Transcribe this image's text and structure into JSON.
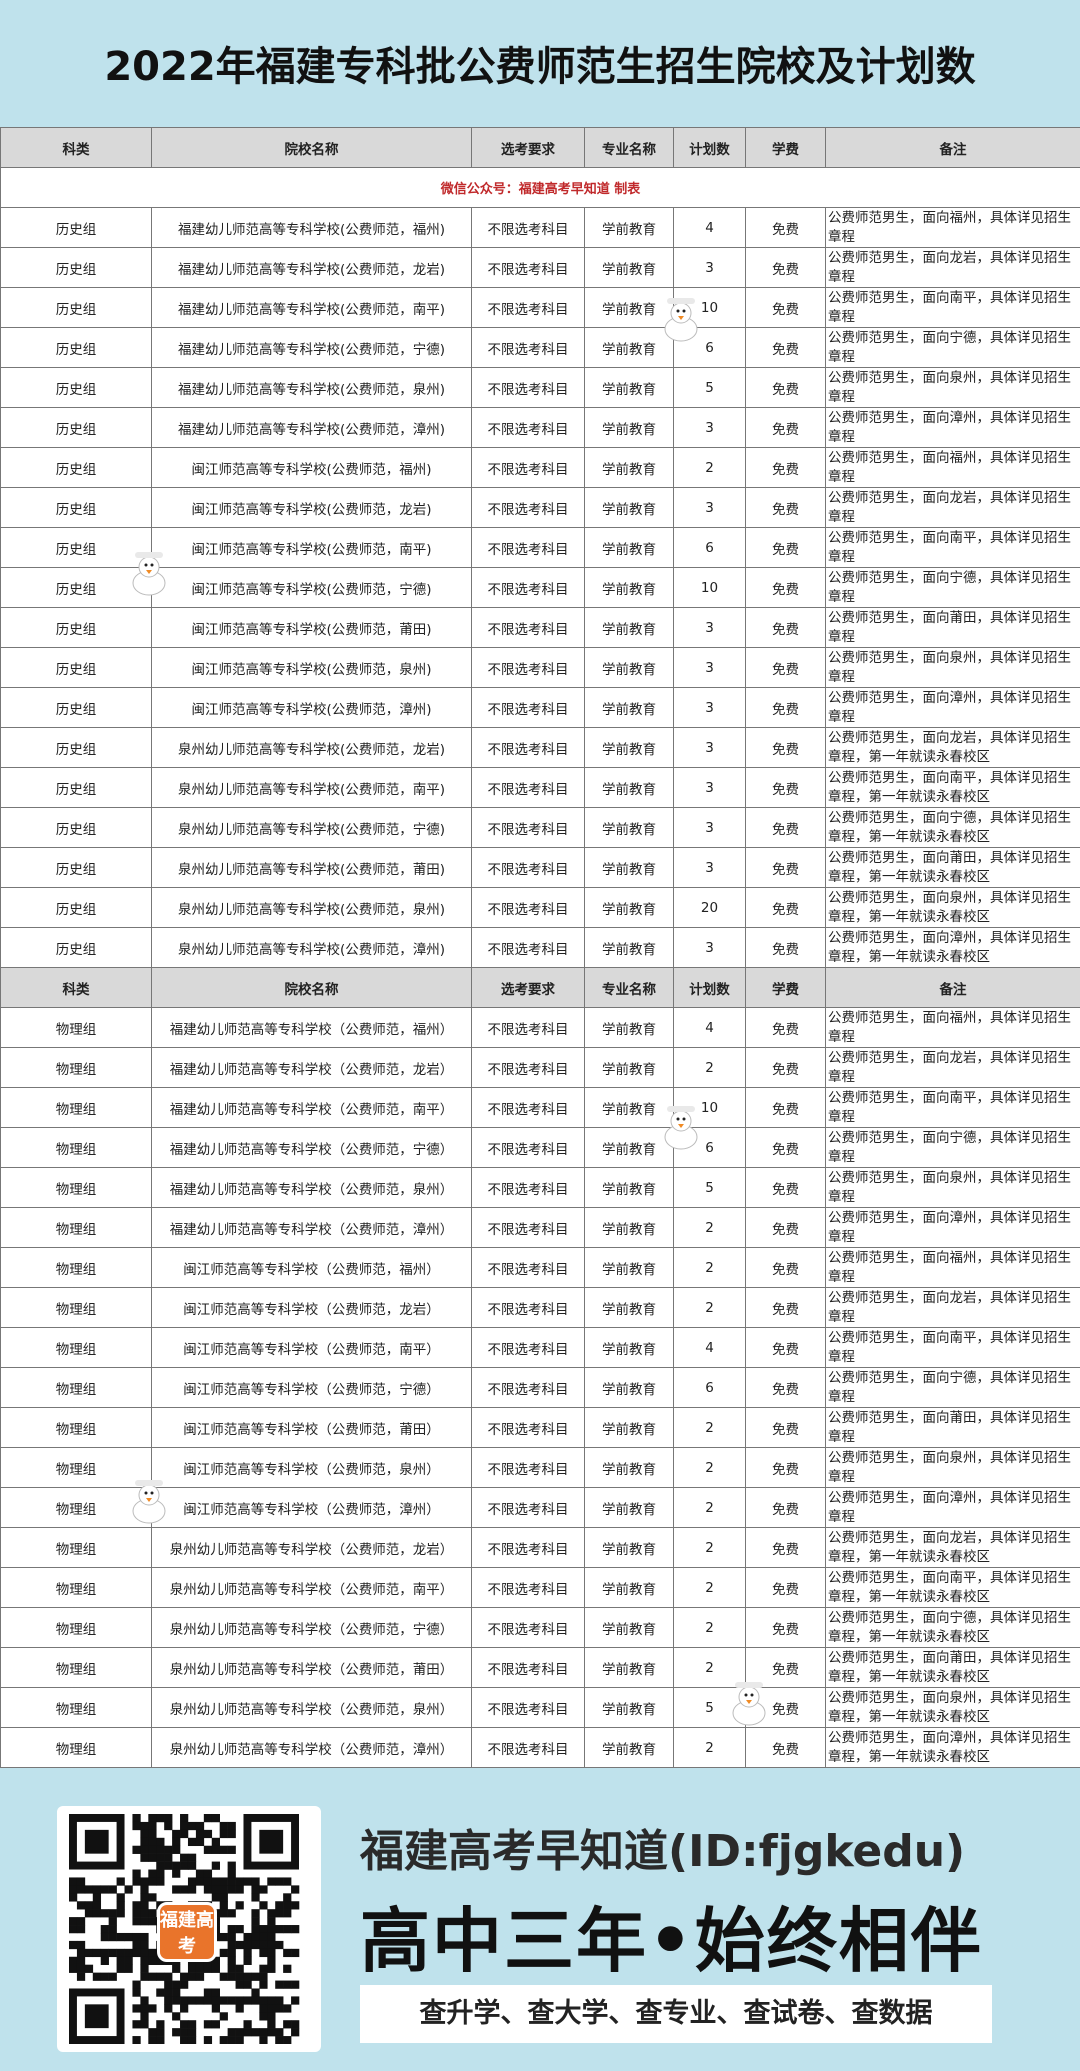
{
  "title": "2022年福建专科批公费师范生招生院校及计划数",
  "columns": [
    "科类",
    "院校名称",
    "选考要求",
    "专业名称",
    "计划数",
    "学费",
    "备注"
  ],
  "banner": "微信公众号：福建高考早知道 制表",
  "history_rows": [
    [
      "历史组",
      "福建幼儿师范高等专科学校(公费师范，福州)",
      "不限选考科目",
      "学前教育",
      "4",
      "免费",
      "公费师范男生，面向福州，具体详见招生章程"
    ],
    [
      "历史组",
      "福建幼儿师范高等专科学校(公费师范，龙岩)",
      "不限选考科目",
      "学前教育",
      "3",
      "免费",
      "公费师范男生，面向龙岩，具体详见招生章程"
    ],
    [
      "历史组",
      "福建幼儿师范高等专科学校(公费师范，南平)",
      "不限选考科目",
      "学前教育",
      "10",
      "免费",
      "公费师范男生，面向南平，具体详见招生章程"
    ],
    [
      "历史组",
      "福建幼儿师范高等专科学校(公费师范，宁德)",
      "不限选考科目",
      "学前教育",
      "6",
      "免费",
      "公费师范男生，面向宁德，具体详见招生章程"
    ],
    [
      "历史组",
      "福建幼儿师范高等专科学校(公费师范，泉州)",
      "不限选考科目",
      "学前教育",
      "5",
      "免费",
      "公费师范男生，面向泉州，具体详见招生章程"
    ],
    [
      "历史组",
      "福建幼儿师范高等专科学校(公费师范，漳州)",
      "不限选考科目",
      "学前教育",
      "3",
      "免费",
      "公费师范男生，面向漳州，具体详见招生章程"
    ],
    [
      "历史组",
      "闽江师范高等专科学校(公费师范，福州)",
      "不限选考科目",
      "学前教育",
      "2",
      "免费",
      "公费师范男生，面向福州，具体详见招生章程"
    ],
    [
      "历史组",
      "闽江师范高等专科学校(公费师范，龙岩)",
      "不限选考科目",
      "学前教育",
      "3",
      "免费",
      "公费师范男生，面向龙岩，具体详见招生章程"
    ],
    [
      "历史组",
      "闽江师范高等专科学校(公费师范，南平)",
      "不限选考科目",
      "学前教育",
      "6",
      "免费",
      "公费师范男生，面向南平，具体详见招生章程"
    ],
    [
      "历史组",
      "闽江师范高等专科学校(公费师范，宁德)",
      "不限选考科目",
      "学前教育",
      "10",
      "免费",
      "公费师范男生，面向宁德，具体详见招生章程"
    ],
    [
      "历史组",
      "闽江师范高等专科学校(公费师范，莆田)",
      "不限选考科目",
      "学前教育",
      "3",
      "免费",
      "公费师范男生，面向莆田，具体详见招生章程"
    ],
    [
      "历史组",
      "闽江师范高等专科学校(公费师范，泉州)",
      "不限选考科目",
      "学前教育",
      "3",
      "免费",
      "公费师范男生，面向泉州，具体详见招生章程"
    ],
    [
      "历史组",
      "闽江师范高等专科学校(公费师范，漳州)",
      "不限选考科目",
      "学前教育",
      "3",
      "免费",
      "公费师范男生，面向漳州，具体详见招生章程"
    ],
    [
      "历史组",
      "泉州幼儿师范高等专科学校(公费师范，龙岩)",
      "不限选考科目",
      "学前教育",
      "3",
      "免费",
      "公费师范男生，面向龙岩，具体详见招生章程，第一年就读永春校区"
    ],
    [
      "历史组",
      "泉州幼儿师范高等专科学校(公费师范，南平)",
      "不限选考科目",
      "学前教育",
      "3",
      "免费",
      "公费师范男生，面向南平，具体详见招生章程，第一年就读永春校区"
    ],
    [
      "历史组",
      "泉州幼儿师范高等专科学校(公费师范，宁德)",
      "不限选考科目",
      "学前教育",
      "3",
      "免费",
      "公费师范男生，面向宁德，具体详见招生章程，第一年就读永春校区"
    ],
    [
      "历史组",
      "泉州幼儿师范高等专科学校(公费师范，莆田)",
      "不限选考科目",
      "学前教育",
      "3",
      "免费",
      "公费师范男生，面向莆田，具体详见招生章程，第一年就读永春校区"
    ],
    [
      "历史组",
      "泉州幼儿师范高等专科学校(公费师范，泉州)",
      "不限选考科目",
      "学前教育",
      "20",
      "免费",
      "公费师范男生，面向泉州，具体详见招生章程，第一年就读永春校区"
    ],
    [
      "历史组",
      "泉州幼儿师范高等专科学校(公费师范，漳州)",
      "不限选考科目",
      "学前教育",
      "3",
      "免费",
      "公费师范男生，面向漳州，具体详见招生章程，第一年就读永春校区"
    ]
  ],
  "physics_rows": [
    [
      "物理组",
      "福建幼儿师范高等专科学校（公费师范，福州）",
      "不限选考科目",
      "学前教育",
      "4",
      "免费",
      "公费师范男生，面向福州，具体详见招生章程"
    ],
    [
      "物理组",
      "福建幼儿师范高等专科学校（公费师范，龙岩）",
      "不限选考科目",
      "学前教育",
      "2",
      "免费",
      "公费师范男生，面向龙岩，具体详见招生章程"
    ],
    [
      "物理组",
      "福建幼儿师范高等专科学校（公费师范，南平）",
      "不限选考科目",
      "学前教育",
      "10",
      "免费",
      "公费师范男生，面向南平，具体详见招生章程"
    ],
    [
      "物理组",
      "福建幼儿师范高等专科学校（公费师范，宁德）",
      "不限选考科目",
      "学前教育",
      "6",
      "免费",
      "公费师范男生，面向宁德，具体详见招生章程"
    ],
    [
      "物理组",
      "福建幼儿师范高等专科学校（公费师范，泉州）",
      "不限选考科目",
      "学前教育",
      "5",
      "免费",
      "公费师范男生，面向泉州，具体详见招生章程"
    ],
    [
      "物理组",
      "福建幼儿师范高等专科学校（公费师范，漳州）",
      "不限选考科目",
      "学前教育",
      "2",
      "免费",
      "公费师范男生，面向漳州，具体详见招生章程"
    ],
    [
      "物理组",
      "闽江师范高等专科学校（公费师范，福州）",
      "不限选考科目",
      "学前教育",
      "2",
      "免费",
      "公费师范男生，面向福州，具体详见招生章程"
    ],
    [
      "物理组",
      "闽江师范高等专科学校（公费师范，龙岩）",
      "不限选考科目",
      "学前教育",
      "2",
      "免费",
      "公费师范男生，面向龙岩，具体详见招生章程"
    ],
    [
      "物理组",
      "闽江师范高等专科学校（公费师范，南平）",
      "不限选考科目",
      "学前教育",
      "4",
      "免费",
      "公费师范男生，面向南平，具体详见招生章程"
    ],
    [
      "物理组",
      "闽江师范高等专科学校（公费师范，宁德）",
      "不限选考科目",
      "学前教育",
      "6",
      "免费",
      "公费师范男生，面向宁德，具体详见招生章程"
    ],
    [
      "物理组",
      "闽江师范高等专科学校（公费师范，莆田）",
      "不限选考科目",
      "学前教育",
      "2",
      "免费",
      "公费师范男生，面向莆田，具体详见招生章程"
    ],
    [
      "物理组",
      "闽江师范高等专科学校（公费师范，泉州）",
      "不限选考科目",
      "学前教育",
      "2",
      "免费",
      "公费师范男生，面向泉州，具体详见招生章程"
    ],
    [
      "物理组",
      "闽江师范高等专科学校（公费师范，漳州）",
      "不限选考科目",
      "学前教育",
      "2",
      "免费",
      "公费师范男生，面向漳州，具体详见招生章程"
    ],
    [
      "物理组",
      "泉州幼儿师范高等专科学校（公费师范，龙岩）",
      "不限选考科目",
      "学前教育",
      "2",
      "免费",
      "公费师范男生，面向龙岩，具体详见招生章程，第一年就读永春校区"
    ],
    [
      "物理组",
      "泉州幼儿师范高等专科学校（公费师范，南平）",
      "不限选考科目",
      "学前教育",
      "2",
      "免费",
      "公费师范男生，面向南平，具体详见招生章程，第一年就读永春校区"
    ],
    [
      "物理组",
      "泉州幼儿师范高等专科学校（公费师范，宁德）",
      "不限选考科目",
      "学前教育",
      "2",
      "免费",
      "公费师范男生，面向宁德，具体详见招生章程，第一年就读永春校区"
    ],
    [
      "物理组",
      "泉州幼儿师范高等专科学校（公费师范，莆田）",
      "不限选考科目",
      "学前教育",
      "2",
      "免费",
      "公费师范男生，面向莆田，具体详见招生章程，第一年就读永春校区"
    ],
    [
      "物理组",
      "泉州幼儿师范高等专科学校（公费师范，泉州）",
      "不限选考科目",
      "学前教育",
      "5",
      "免费",
      "公费师范男生，面向泉州，具体详见招生章程，第一年就读永春校区"
    ],
    [
      "物理组",
      "泉州幼儿师范高等专科学校（公费师范，漳州）",
      "不限选考科目",
      "学前教育",
      "2",
      "免费",
      "公费师范男生，面向漳州，具体详见招生章程，第一年就读永春校区"
    ]
  ],
  "footer": {
    "qr_badge": "福建高考",
    "brand": "福建高考早知道(ID:fjgkedu)",
    "slogan": "高中三年•始终相伴",
    "services": "查升学、查大学、查专业、查试卷、查数据"
  },
  "colors": {
    "background": "#bfe2ec",
    "header_row": "#d9d9d9",
    "banner_text": "#c0292b",
    "qr_badge": "#e9742b"
  },
  "icons": [
    "duck-mascot-icon",
    "qr-code-icon"
  ]
}
